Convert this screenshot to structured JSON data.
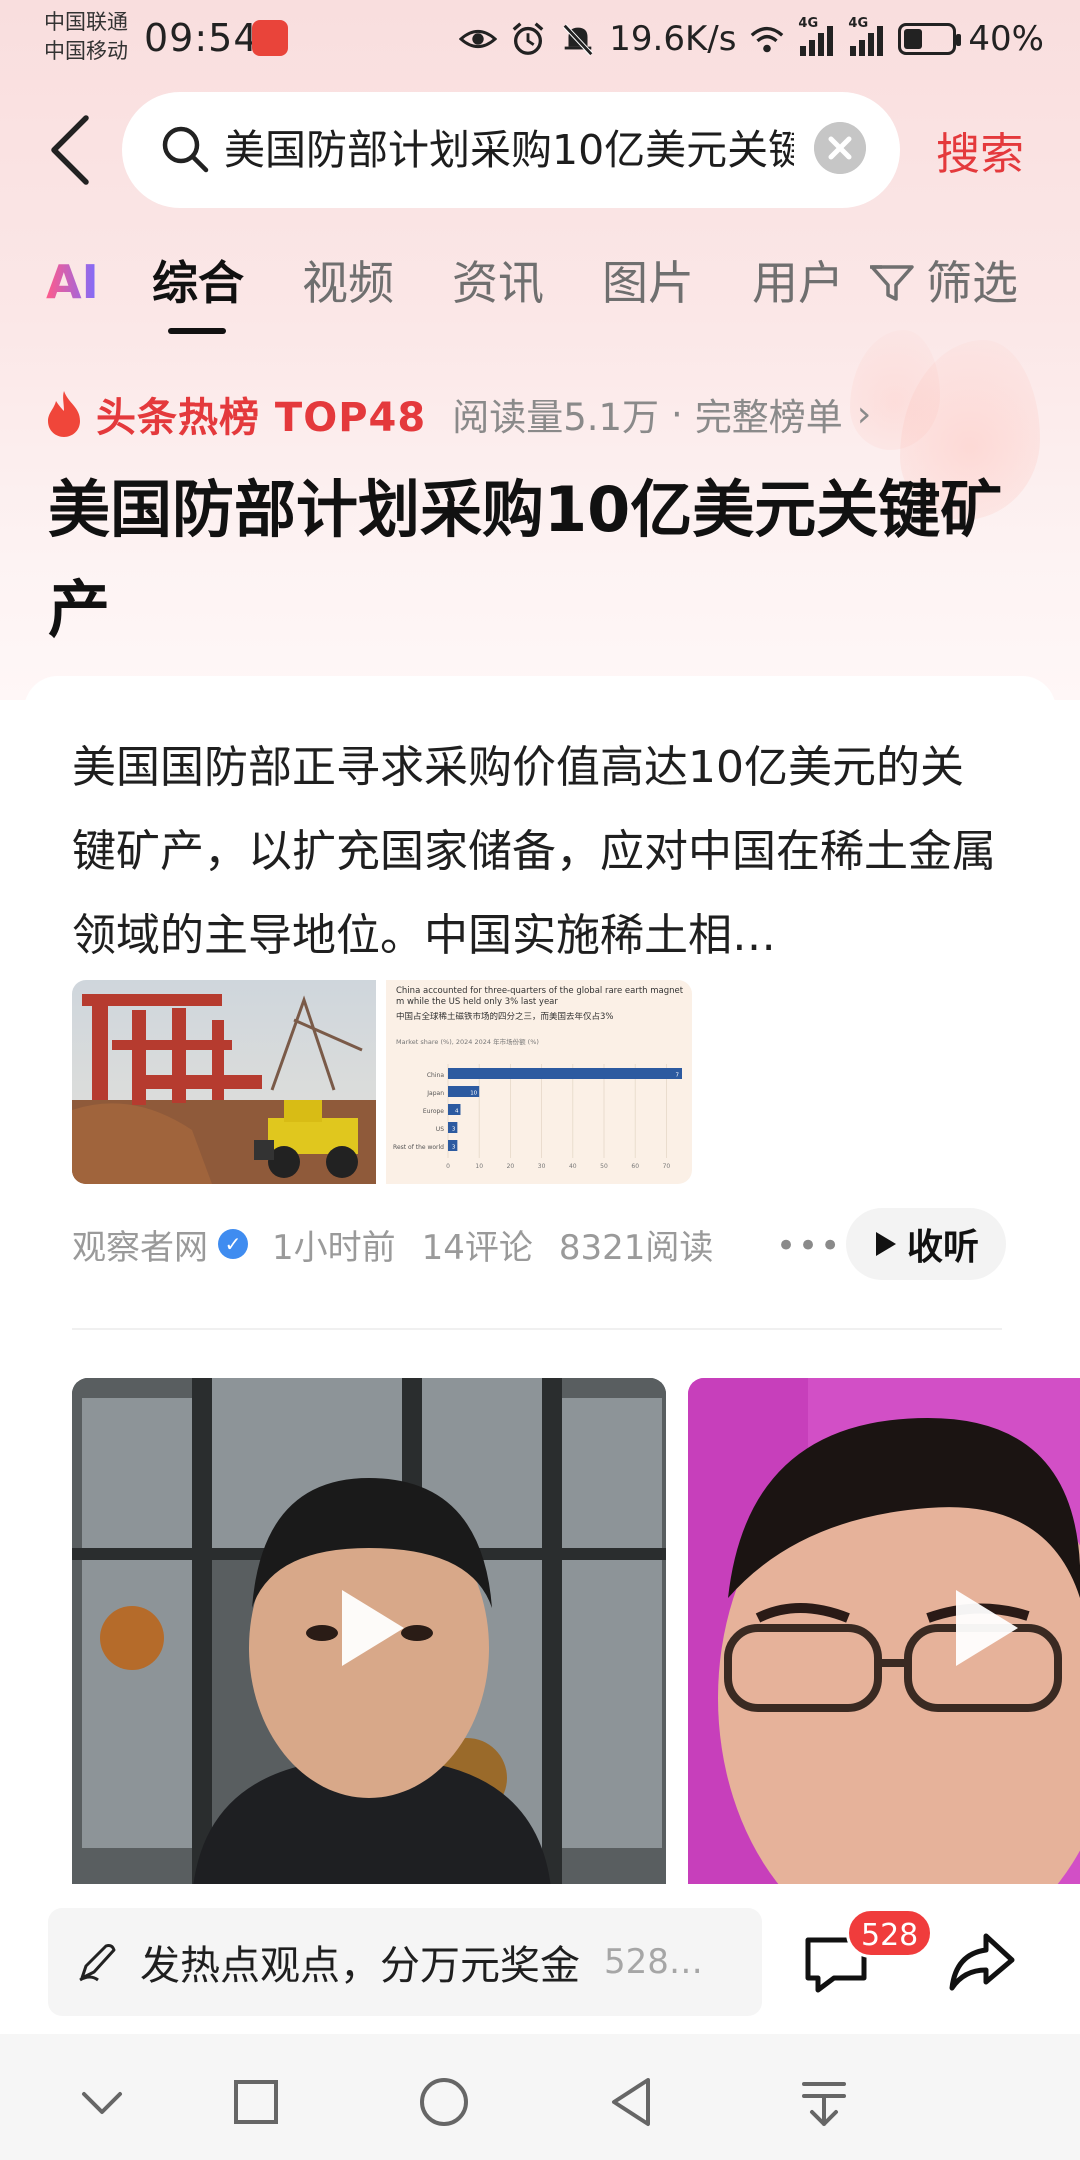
{
  "status_bar": {
    "carrier_1": "中国联通",
    "carrier_2": "中国移动",
    "time": "09:54",
    "net_speed": "19.6K/s",
    "network_1": "4G",
    "network_2": "4G",
    "battery": "40%",
    "battery_level": 0.4
  },
  "search": {
    "query": "美国防部计划采购10亿美元关键矿产",
    "search_label": "搜索"
  },
  "tabs": {
    "ai": "AI",
    "items": [
      "综合",
      "视频",
      "资讯",
      "图片",
      "用户"
    ],
    "active": "综合",
    "filter": "筛选"
  },
  "hot": {
    "label": "头条热榜 TOP48",
    "reads": "阅读量5.1万",
    "separator": "·",
    "full_list": "完整榜单",
    "title": "美国防部计划采购10亿美元关键矿产"
  },
  "article": {
    "summary": "美国国防部正寻求采购价值高达10亿美元的关键矿产，以扩充国家储备，应对中国在稀土金属领域的主导地位。中国实施稀土相…",
    "source": "观察者网",
    "time": "1小时前",
    "comments": "14评论",
    "reads": "8321阅读",
    "listen": "收听",
    "chart_thumb": {
      "title_en": "China accounted for three-quarters of the global rare earth magnet m while the US held only 3% last year",
      "title_cn": "中国占全球稀土磁铁市场的四分之三，而美国去年仅占3%",
      "subtitle": "Market share (%), 2024  2024 年市场份额 (%)",
      "categories": [
        "China",
        "Japan",
        "Europe",
        "US",
        "Rest of the world"
      ],
      "values": [
        75,
        10,
        4,
        3,
        3
      ],
      "bar_labels": [
        "7",
        "10",
        "4",
        "3",
        "3"
      ],
      "ticks": [
        "0",
        "10",
        "20",
        "30",
        "40",
        "50",
        "60",
        "70"
      ],
      "bar_color": "#2c5aa0"
    }
  },
  "comment_bar": {
    "placeholder": "发热点观点，分万元奖金",
    "count_inline": "528…",
    "badge": "528"
  },
  "colors": {
    "accent": "#e4393c"
  }
}
